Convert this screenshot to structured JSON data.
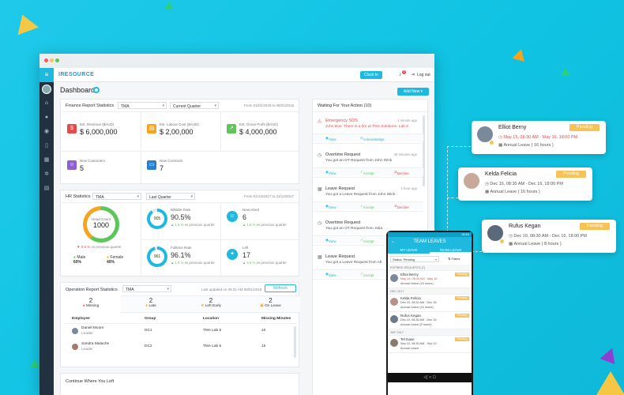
{
  "app": {
    "brand": "IRESOURCE",
    "clock_in": "Clock In",
    "logout": "Log out",
    "notif_count": "2",
    "page_title": "Dashboard",
    "add_new": "Add New"
  },
  "finance": {
    "title": "Finance Report Statistics",
    "company": "TMA",
    "period": "Current Quarter",
    "range": "From 01/01/2018 to 08/01/2018",
    "kpis": [
      {
        "label": "Est. Revenue ($AUD)",
        "value": "$ 6,000,000"
      },
      {
        "label": "Est. Labour Cost ($AUD)",
        "value": "$ 2,00,000"
      },
      {
        "label": "Est. Gross Profit ($AUD)",
        "value": "$ 4,000,000"
      },
      {
        "label": "New Customers",
        "value": "5"
      },
      {
        "label": "New Contracts",
        "value": "7"
      }
    ]
  },
  "hr": {
    "title": "HR Statistics",
    "company": "TMA",
    "period": "Last Quarter",
    "range": "From 01/12/2017 to 31/12/2017",
    "headcount_label": "Head Count",
    "headcount": "1000",
    "headcount_change": "▼ 0.6 %",
    "vs": "vs previous quarter",
    "male": "Male",
    "male_pct": "60%",
    "female": "Female",
    "female_pct": "40%",
    "billable_label": "Billable Rate",
    "billable_ring": "905",
    "billable": "90.5%",
    "billable_change": "▲ 1.6 %",
    "fulltime_label": "Fulltime Rate",
    "fulltime_ring": "961",
    "fulltime": "96.1%",
    "fulltime_change": "▲ 1.0 %",
    "new_hired_label": "New Hired",
    "new_hired": "6",
    "new_hired_change": "▲ 1.6 %",
    "left_label": "Left",
    "left": "17",
    "left_change": "▲ 5.0 %"
  },
  "operation": {
    "title": "Operation Report Statistics",
    "company": "TMA",
    "updated": "Last updated on 08:31 AM 08/01/2018",
    "refresh": "Refresh",
    "tabs": [
      {
        "num": "2",
        "label": "Missing"
      },
      {
        "num": "2",
        "label": "Late"
      },
      {
        "num": "2",
        "label": "Left Early"
      },
      {
        "num": "2",
        "label": "On Leave"
      }
    ],
    "cols": [
      "Employee",
      "Group",
      "Location",
      "Missing Minutes"
    ],
    "rows": [
      {
        "name": "Daniel Moore",
        "role": "Leader",
        "group": "DC1",
        "loc": "TMA Lab 6",
        "min": "10"
      },
      {
        "name": "Sandra Matache",
        "role": "Leader",
        "group": "DC2",
        "loc": "TMA Lab 6",
        "min": "15"
      }
    ]
  },
  "continue": {
    "title": "Continue Where You Left"
  },
  "waiting": {
    "title": "Waiting For Your Action (10)",
    "view": "View",
    "acknowledge": "Acknowledge",
    "accept": "Accept",
    "decline": "Decline",
    "items": [
      {
        "title": "Emergency SOS",
        "sub": "John Doe: There is a fire at TMA Solutions- Lab 6",
        "ago": "1 minute ago"
      },
      {
        "title": "Overtime Request",
        "sub": "You got an OT Request from John Wick",
        "ago": "45 minutes ago"
      },
      {
        "title": "Leave Request",
        "sub": "You got a Leave Request from John Wick",
        "ago": "1 hour ago"
      },
      {
        "title": "Overtime Request",
        "sub": "You got an OT Request from Julia",
        "ago": ""
      },
      {
        "title": "Leave Request",
        "sub": "You got a Leave Request from All",
        "ago": ""
      }
    ]
  },
  "phone": {
    "time": "16:54",
    "title": "TEAM LEAVES",
    "tab1": "MY LEAVE",
    "tab2": "TEAM LEAVE",
    "status": "Status: Pending",
    "filters": "Filters",
    "expired": "EXPIRED REQUESTS (7)",
    "dec": "DEC 2017",
    "sep": "SEP 2017",
    "items": [
      {
        "name": "Elliot Berny",
        "date": "May 15, 08:30 AM - May 16",
        "leave": "Annual Leave (16 hours)"
      },
      {
        "name": "Kelda Felicia",
        "date": "Dec 15, 08:30 AM - Dec 16",
        "leave": "Annual Leave (16 hours)"
      },
      {
        "name": "Rufus Kegan",
        "date": "Dec 10, 08:30 AM - Dec 16",
        "leave": "Annual Leave (8 hours)"
      },
      {
        "name": "Tel Isaac",
        "date": "Sep 10, 08:30 AM - Sep 10",
        "leave": "Annual Leave"
      }
    ],
    "pending": "Pending"
  },
  "cards": [
    {
      "name": "Elliot Berny",
      "status": "Pending",
      "dates": "May 15, 08:30 AM - May 16, 18:00 PM",
      "leave": "Annual Leave ( 16 hours )"
    },
    {
      "name": "Kelda Felicia",
      "status": "Pending",
      "dates": "Dec 15, 08:30 AM - Dec 16, 18:00 PM",
      "leave": "Annual Leave ( 16 hours )"
    },
    {
      "name": "Rufus Kegan",
      "status": "Pending",
      "dates": "Dec 10, 08:30 AM - Dec 16, 18:00 PM",
      "leave": "Annual Leave ( 8 hours )"
    }
  ],
  "colors": {
    "accent": "#1fb9e0",
    "green": "#5cc65a",
    "orange": "#f7a31e",
    "red": "#e84a4a",
    "pending": "#f7c257"
  }
}
